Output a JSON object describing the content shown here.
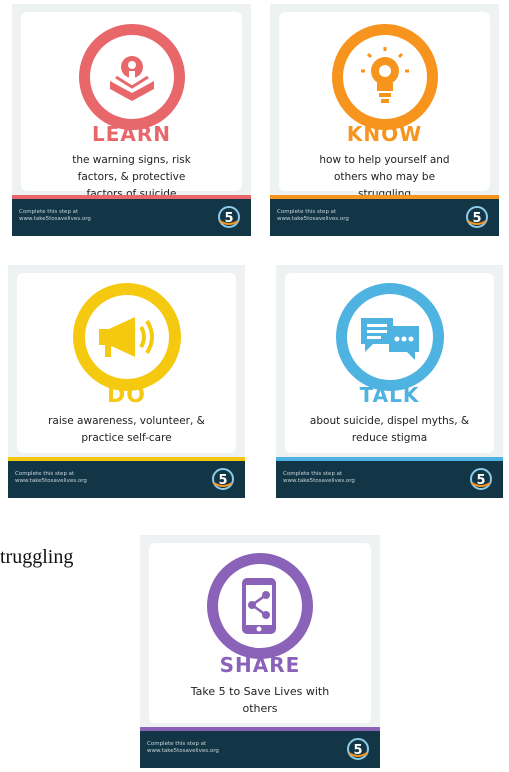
{
  "colors": {
    "learn": "#e8676b",
    "know": "#f7941d",
    "do": "#f5c90f",
    "talk": "#4fb3e1",
    "share": "#8a63b8",
    "footer": "#123646"
  },
  "cards": [
    {
      "word": "LEARN",
      "description": "the warning signs, risk factors, & protective factors of suicide",
      "icon": "book-lightbulb-icon",
      "footer_line1": "Complete this step at",
      "footer_line2": "www.take5tosavelives.org"
    },
    {
      "word": "KNOW",
      "description": "how to help yourself and others who may be struggling",
      "icon": "lightbulb-icon",
      "footer_line1": "Complete this step at",
      "footer_line2": "www.take5tosavelives.org"
    },
    {
      "word": "DO",
      "description": "raise awareness, volunteer, & practice self-care",
      "icon": "megaphone-icon",
      "footer_line1": "Complete this step at",
      "footer_line2": "www.take5tosavelives.org"
    },
    {
      "word": "TALK",
      "description": "about suicide, dispel myths, & reduce stigma",
      "icon": "speech-bubbles-icon",
      "footer_line1": "Complete this step at",
      "footer_line2": "www.take5tosavelives.org"
    },
    {
      "word": "SHARE",
      "description": "Take 5 to Save Lives with others",
      "icon": "phone-share-icon",
      "footer_line1": "Complete this step at",
      "footer_line2": "www.take5tosavelives.org"
    }
  ],
  "logo_text": "5",
  "side_text": "truggling"
}
